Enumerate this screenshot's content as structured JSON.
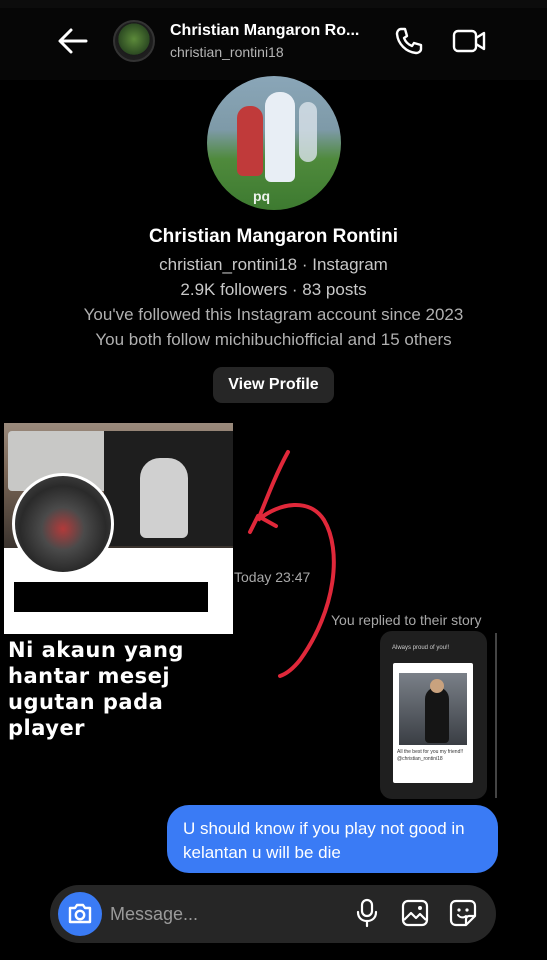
{
  "header": {
    "name": "Christian Mangaron Ro...",
    "username": "christian_rontini18"
  },
  "profile": {
    "name": "Christian Mangaron Rontini",
    "handle_line": "christian_rontini18 · Instagram",
    "stats_line": "2.9K followers · 83 posts",
    "follow_since": "You've followed this Instagram account since 2023",
    "mutual": "You both follow michibuchiofficial and 15 others",
    "view_profile_label": "View Profile",
    "photo_watermark": "pq"
  },
  "chat": {
    "timestamp": "Today 23:47",
    "reply_label": "You replied to their story",
    "story": {
      "top_text": "Always proud of you!!",
      "caption": "All the best for you my friend!!",
      "mention": "@christian_rontini18"
    },
    "message": "U should know if you play not good in kelantan u will be die"
  },
  "overlay": {
    "caption": "Ni akaun yang hantar mesej ugutan pada player"
  },
  "composer": {
    "placeholder": "Message..."
  },
  "colors": {
    "accent": "#3a7bf5",
    "annotation_arrow": "#e0283a",
    "background": "#000000"
  },
  "icons": {
    "back": "arrow-left-icon",
    "call": "phone-icon",
    "video": "video-camera-icon",
    "camera": "camera-icon",
    "mic": "microphone-icon",
    "gallery": "image-icon",
    "sticker": "sticker-icon"
  }
}
